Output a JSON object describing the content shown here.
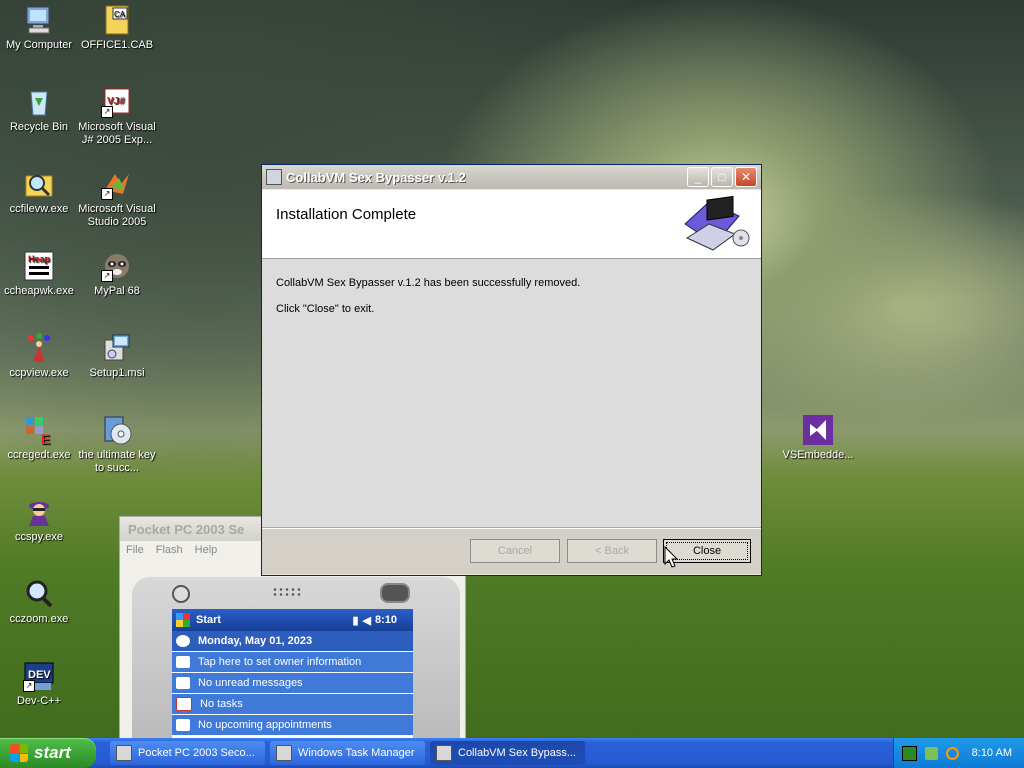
{
  "desktop": {
    "icons_left": [
      {
        "label": "My Computer",
        "icon": "computer-icon"
      },
      {
        "label": "Recycle Bin",
        "icon": "recycle-bin-icon"
      },
      {
        "label": "ccfilevw.exe",
        "icon": "magnifier-folder-icon"
      },
      {
        "label": "ccheapwk.exe",
        "icon": "heap-icon"
      },
      {
        "label": "ccpview.exe",
        "icon": "juggler-icon"
      },
      {
        "label": "ccregedt.exe",
        "icon": "registry-icon"
      },
      {
        "label": "ccspy.exe",
        "icon": "spy-icon"
      },
      {
        "label": "cczoom.exe",
        "icon": "zoom-icon"
      },
      {
        "label": "Dev-C++",
        "icon": "devcpp-icon"
      }
    ],
    "icons_right": [
      {
        "label": "OFFICE1.CAB",
        "icon": "cab-file-icon"
      },
      {
        "label": "Microsoft Visual J# 2005 Exp...",
        "icon": "vj-icon"
      },
      {
        "label": "Microsoft Visual Studio 2005",
        "icon": "visual-studio-icon"
      },
      {
        "label": "MyPal 68",
        "icon": "raccoon-icon"
      },
      {
        "label": "Setup1.msi",
        "icon": "msi-icon"
      },
      {
        "label": "the ultimate key to succ...",
        "icon": "cd-icon"
      }
    ],
    "icon_far": {
      "label": "VSEmbedde...",
      "icon": "vs-embedded-icon"
    }
  },
  "installer": {
    "title": "CollabVM Sex Bypasser v.1.2",
    "heading": "Installation Complete",
    "message": "CollabVM Sex Bypasser v.1.2 has been successfully removed.",
    "hint": "Click \"Close\" to exit.",
    "buttons": {
      "cancel": "Cancel",
      "back": "< Back",
      "close": "Close"
    }
  },
  "pocketpc": {
    "title": "Pocket PC 2003 Se",
    "menu": [
      "File",
      "Flash",
      "Help"
    ],
    "start": "Start",
    "time": "8:10",
    "date": "Monday, May 01, 2023",
    "rows": [
      "Tap here to set owner information",
      "No unread messages",
      "No tasks",
      "No upcoming appointments"
    ]
  },
  "taskbar": {
    "start": "start",
    "buttons": [
      "Pocket PC 2003 Seco...",
      "Windows Task Manager",
      "CollabVM Sex Bypass..."
    ],
    "clock": "8:10 AM"
  },
  "colors": {
    "xp_blue": "#245bd2",
    "start_green": "#2b8a26",
    "tray_blue": "#0e7bd6"
  }
}
